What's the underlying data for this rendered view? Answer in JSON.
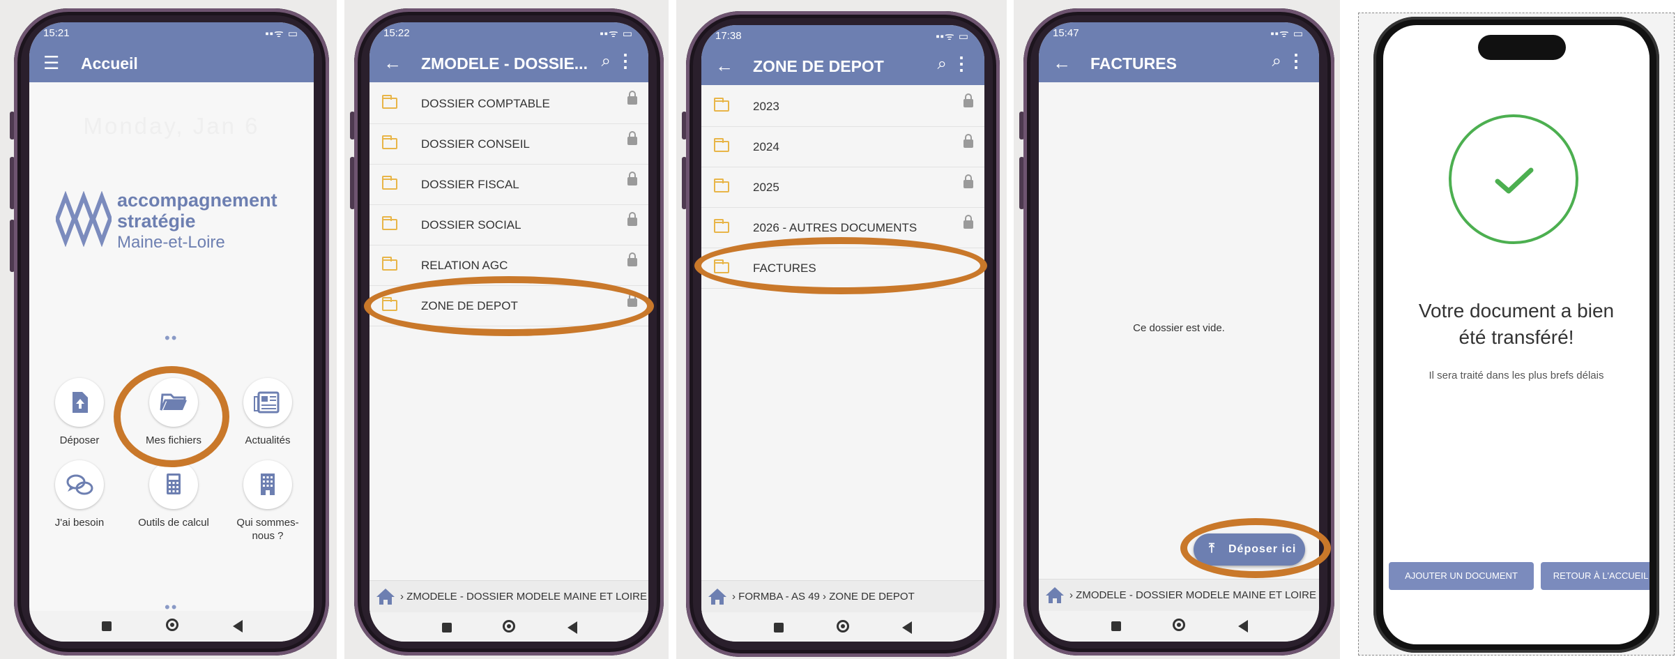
{
  "panel1": {
    "status_time": "15:21",
    "status_right": "▪▪ᯤ ▭",
    "appbar_title": "Accueil",
    "date": "Monday, Jan 6",
    "logo_line1": "accompagnement",
    "logo_line2": "stratégie",
    "logo_line3": "Maine-et-Loire",
    "tiles": [
      {
        "label": "Déposer",
        "icon": "upload-file-icon"
      },
      {
        "label": "Mes fichiers",
        "icon": "folder-open-icon"
      },
      {
        "label": "Actualités",
        "icon": "newspaper-icon"
      },
      {
        "label": "J'ai besoin",
        "icon": "chat-icon"
      },
      {
        "label": "Outils de calcul",
        "icon": "calculator-icon"
      },
      {
        "label": "Qui sommes-nous ?",
        "icon": "building-icon"
      }
    ]
  },
  "panel2": {
    "status_time": "15:22",
    "appbar_title": "ZMODELE - DOSSIE...",
    "folders": [
      "DOSSIER COMPTABLE",
      "DOSSIER CONSEIL",
      "DOSSIER FISCAL",
      "DOSSIER SOCIAL",
      "RELATION AGC",
      "ZONE DE DEPOT"
    ],
    "breadcrumb": "ZMODELE - DOSSIER MODELE MAINE ET LOIRE"
  },
  "panel3": {
    "status_time": "17:38",
    "appbar_title": "ZONE DE DEPOT",
    "folders": [
      "2023",
      "2024",
      "2025",
      "2026 - AUTRES DOCUMENTS",
      "FACTURES"
    ],
    "breadcrumb_1": "FORMBA - AS 49",
    "breadcrumb_2": "ZONE DE DEPOT"
  },
  "panel4": {
    "status_time": "15:47",
    "appbar_title": "FACTURES",
    "empty_text": "Ce dossier est vide.",
    "deposit_button": "Déposer ici",
    "breadcrumb": "ZMODELE - DOSSIER MODELE MAINE ET LOIRE"
  },
  "panel5": {
    "heading_line1": "Votre document a bien",
    "heading_line2": "été transféré!",
    "subtext": "Il sera traité dans les plus brefs délais",
    "button_add": "AJOUTER UN DOCUMENT",
    "button_home": "RETOUR À L'ACCUEIL"
  },
  "colors": {
    "appbar": "#6d7fb1",
    "highlight_ring": "#c9782a",
    "success_green": "#4caf50",
    "folder_yellow": "#e8b548"
  }
}
